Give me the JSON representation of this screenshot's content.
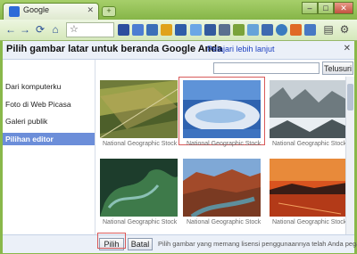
{
  "browser": {
    "tab_title": "Google",
    "tab_close": "✕",
    "new_tab": "+",
    "win_min": "–",
    "win_max": "□",
    "win_close": "✕"
  },
  "toolbar": {
    "back": "←",
    "forward": "→",
    "reload": "⟳",
    "home": "⌂",
    "star": "☆",
    "menu": "⚙"
  },
  "dialog": {
    "title": "Pilih gambar latar untuk beranda Google Anda",
    "learn_more": "Pelajari lebih lanjut",
    "close": "✕",
    "search_placeholder": "",
    "search_button": "Telusuri",
    "sidebar": [
      {
        "label": "Dari komputerku",
        "active": false
      },
      {
        "label": "Foto di Web Picasa",
        "active": false
      },
      {
        "label": "Galeri publik",
        "active": false
      },
      {
        "label": "Pilihan editor",
        "active": true
      }
    ],
    "images": [
      {
        "caption": "National Geographic Stock",
        "selected": false
      },
      {
        "caption": "National Geographic Stock",
        "selected": true
      },
      {
        "caption": "National Geographic Stock",
        "selected": false
      },
      {
        "caption": "National Geographic Stock",
        "selected": false
      },
      {
        "caption": "National Geographic Stock",
        "selected": false
      },
      {
        "caption": "National Geographic Stock",
        "selected": false
      }
    ],
    "select_button": "Pilih",
    "cancel_button": "Batal",
    "footer_text": "Pilih gambar yang memang lisensi penggunaannya telah Anda pegang."
  },
  "colors": {
    "frame": "#89b84a",
    "accent": "#6c8ed9",
    "highlight": "#d85a5a"
  }
}
